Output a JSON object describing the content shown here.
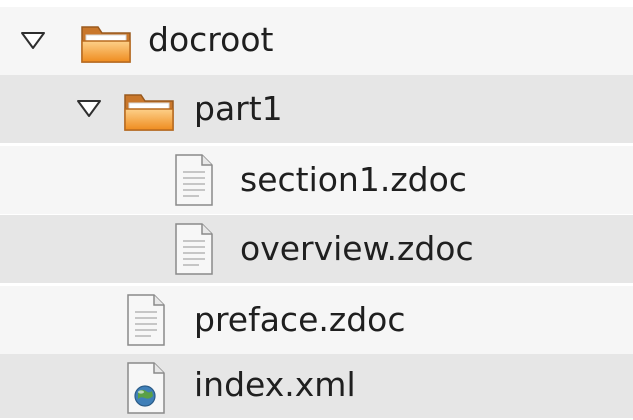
{
  "tree": {
    "items": [
      {
        "label": "docroot",
        "type": "folder",
        "expanded": true
      },
      {
        "label": "part1",
        "type": "folder",
        "expanded": true
      },
      {
        "label": "section1.zdoc",
        "type": "document"
      },
      {
        "label": "overview.zdoc",
        "type": "document"
      },
      {
        "label": "preface.zdoc",
        "type": "document"
      },
      {
        "label": "index.xml",
        "type": "xml-document"
      }
    ]
  },
  "icons": {
    "expander": "triangle-down-icon",
    "folder": "folder-open-icon",
    "document": "text-document-icon",
    "xml": "xml-document-icon"
  },
  "colors": {
    "row_alt": "#e6e6e6",
    "row_plain": "#f6f6f6",
    "folder_orange": "#f5a03b",
    "text": "#1f1f1f"
  }
}
